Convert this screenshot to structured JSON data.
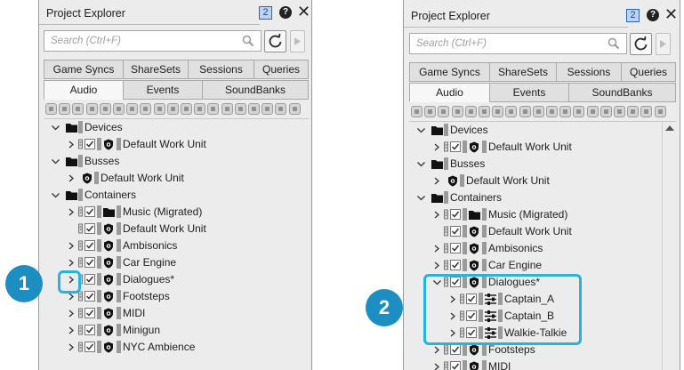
{
  "callouts": [
    "1",
    "2"
  ],
  "panel_title": "Project Explorer",
  "badge": "2",
  "help_glyph": "?",
  "close_glyph": "✕",
  "search_placeholder": "Search (Ctrl+F)",
  "tabs_top": [
    "Game Syncs",
    "ShareSets",
    "Sessions",
    "Queries"
  ],
  "tabs_bottom": [
    "Audio",
    "Events",
    "SoundBanks"
  ],
  "active_tab": "Audio",
  "icons": {
    "search": "magnifier-icon",
    "sync": "refresh-icon",
    "play": "play-icon",
    "expand": "chevron-right-icon",
    "collapse": "chevron-down-icon",
    "folder": "folder-icon",
    "work_unit": "work-unit-icon",
    "actor_mixer": "actor-mixer-icon",
    "random_container": "random-container-icon",
    "checkbox": "checkbox-icon"
  },
  "colors": {
    "highlight": "#2bb1da",
    "callout": "#1d8ec2"
  },
  "left_tree": [
    {
      "label": "Devices",
      "kind": "folder",
      "expanded": true
    },
    {
      "label": "Default Work Unit",
      "kind": "workunit"
    },
    {
      "label": "Busses",
      "kind": "folder",
      "expanded": true
    },
    {
      "label": "Default Work Unit",
      "kind": "workunit"
    },
    {
      "label": "Containers",
      "kind": "folder",
      "expanded": true
    },
    {
      "label": "Music (Migrated)",
      "kind": "subfolder"
    },
    {
      "label": "Default Work Unit",
      "kind": "workunit"
    },
    {
      "label": "Ambisonics",
      "kind": "workunit"
    },
    {
      "label": "Car Engine",
      "kind": "workunit"
    },
    {
      "label": "Dialogues*",
      "kind": "workunit"
    },
    {
      "label": "Footsteps",
      "kind": "workunit"
    },
    {
      "label": "MIDI",
      "kind": "workunit"
    },
    {
      "label": "Minigun",
      "kind": "workunit"
    },
    {
      "label": "NYC Ambience",
      "kind": "workunit"
    }
  ],
  "right_tree": [
    {
      "label": "Devices",
      "kind": "folder",
      "expanded": true
    },
    {
      "label": "Default Work Unit",
      "kind": "workunit"
    },
    {
      "label": "Busses",
      "kind": "folder",
      "expanded": true
    },
    {
      "label": "Default Work Unit",
      "kind": "workunit"
    },
    {
      "label": "Containers",
      "kind": "folder",
      "expanded": true
    },
    {
      "label": "Music (Migrated)",
      "kind": "subfolder"
    },
    {
      "label": "Default Work Unit",
      "kind": "workunit"
    },
    {
      "label": "Ambisonics",
      "kind": "workunit"
    },
    {
      "label": "Car Engine",
      "kind": "workunit"
    },
    {
      "label": "Dialogues*",
      "kind": "workunit",
      "expanded": true
    },
    {
      "label": "Captain_A",
      "kind": "mixer"
    },
    {
      "label": "Captain_B",
      "kind": "mixer"
    },
    {
      "label": "Walkie-Talkie",
      "kind": "mixer"
    },
    {
      "label": "Footsteps",
      "kind": "workunit"
    },
    {
      "label": "MIDI",
      "kind": "workunit"
    }
  ]
}
